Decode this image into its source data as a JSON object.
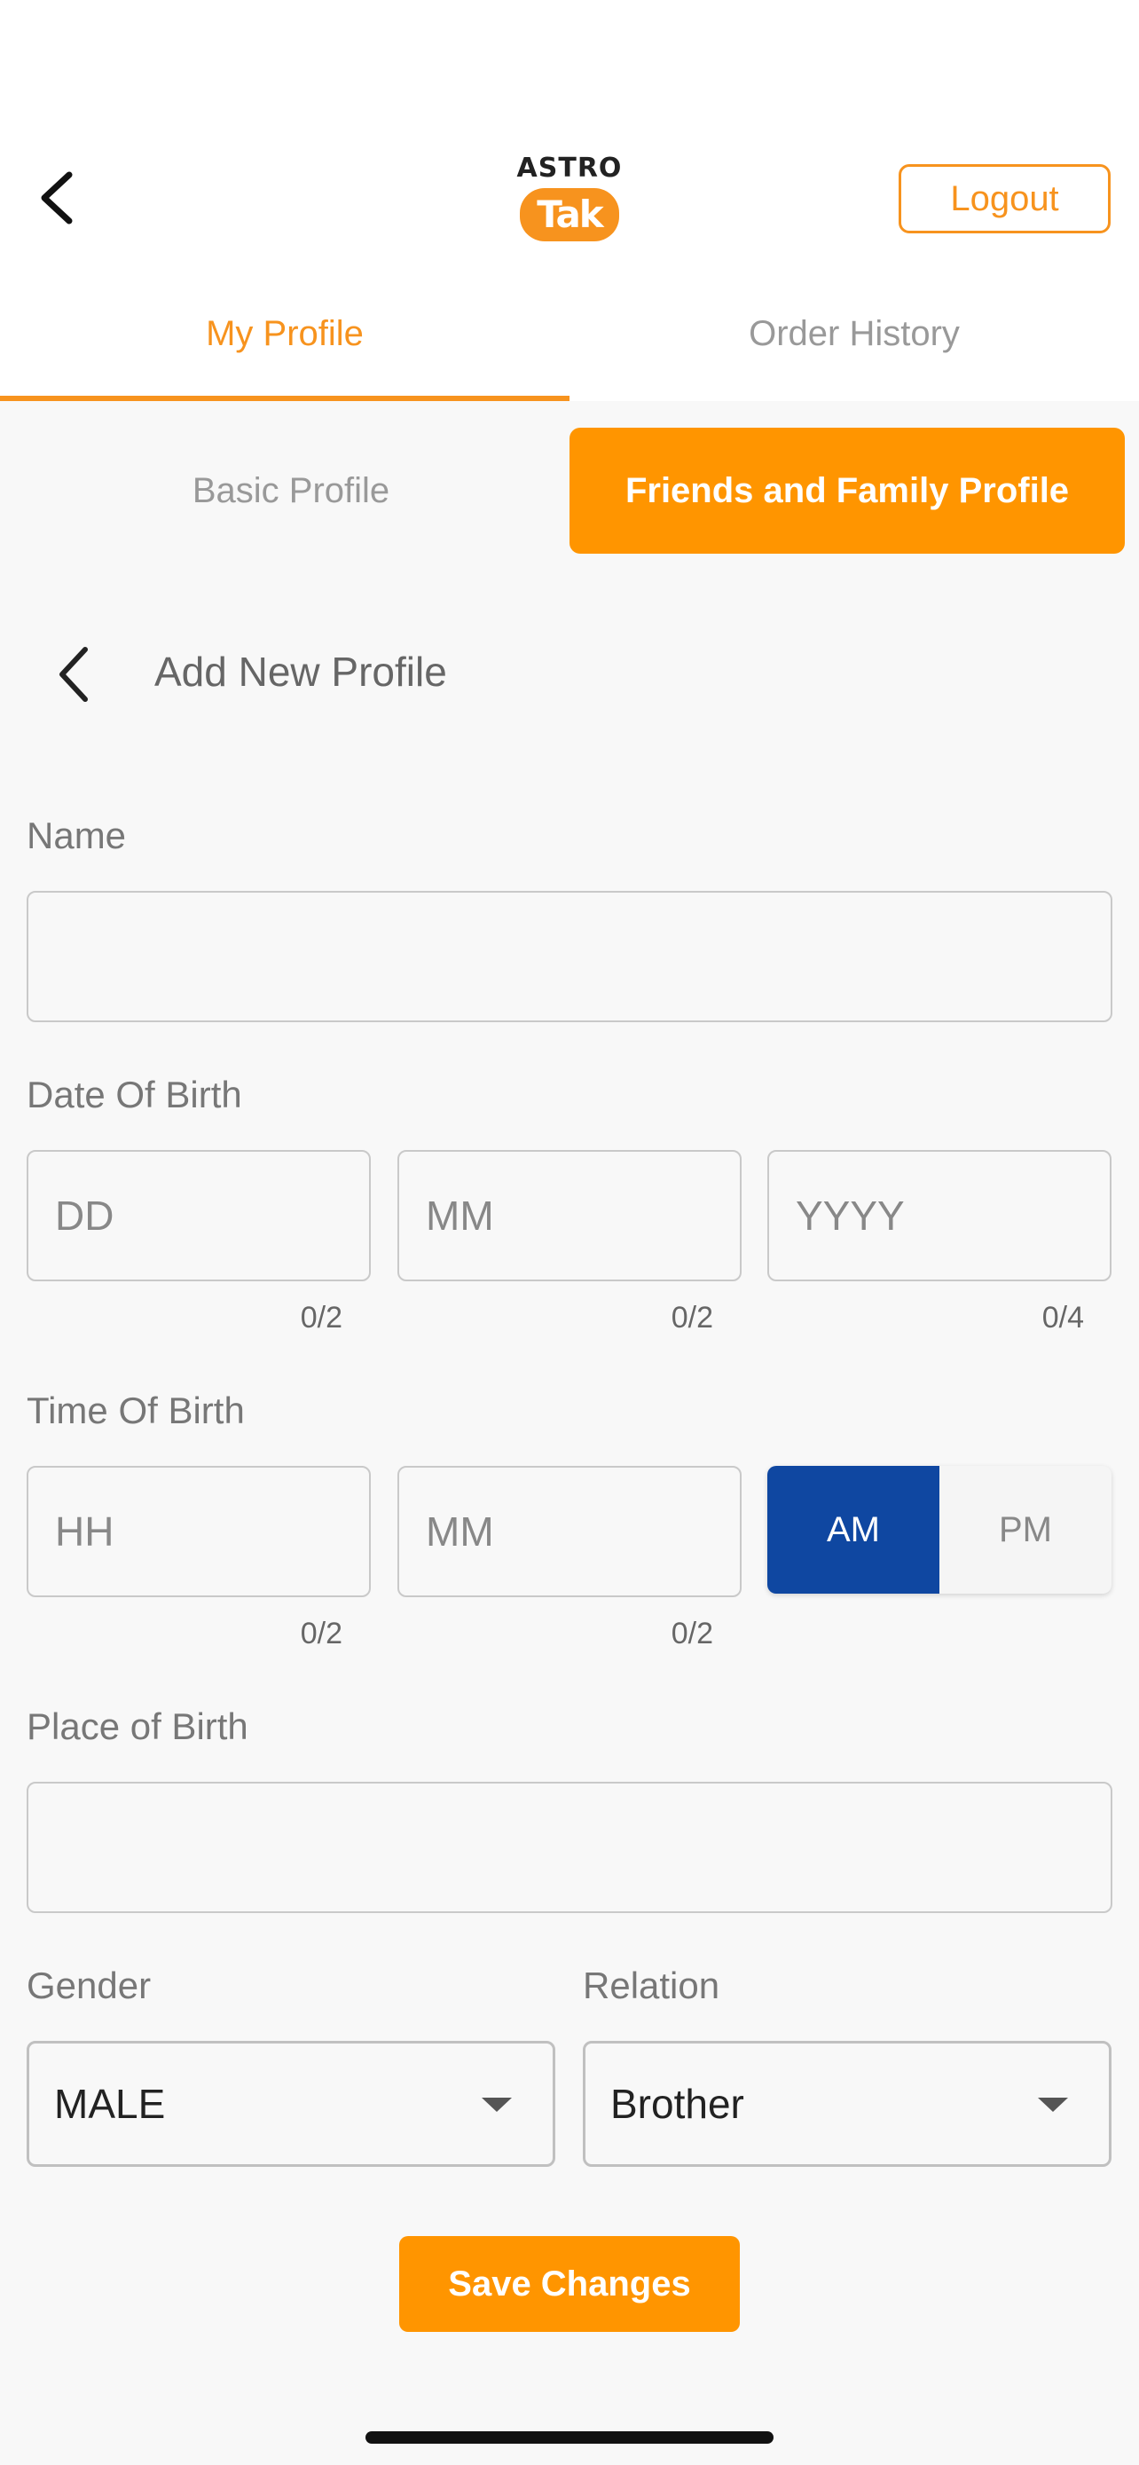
{
  "header": {
    "logo_top": "ASTRO",
    "logo_bottom": "Tak",
    "logout_label": "Logout",
    "brand_color": "#f7931e"
  },
  "tabs": [
    {
      "label": "My Profile",
      "active": true
    },
    {
      "label": "Order History",
      "active": false
    }
  ],
  "segments": [
    {
      "label": "Basic Profile",
      "active": false
    },
    {
      "label": "Friends and Family Profile",
      "active": true
    }
  ],
  "subheader": {
    "title": "Add New Profile"
  },
  "form": {
    "name": {
      "label": "Name",
      "value": ""
    },
    "dob": {
      "label": "Date Of Birth",
      "day": {
        "placeholder": "DD",
        "counter": "0/2"
      },
      "month": {
        "placeholder": "MM",
        "counter": "0/2"
      },
      "year": {
        "placeholder": "YYYY",
        "counter": "0/4"
      }
    },
    "tob": {
      "label": "Time Of Birth",
      "hour": {
        "placeholder": "HH",
        "counter": "0/2"
      },
      "minute": {
        "placeholder": "MM",
        "counter": "0/2"
      },
      "am_label": "AM",
      "pm_label": "PM",
      "selected": "AM"
    },
    "place": {
      "label": "Place of Birth",
      "value": ""
    },
    "gender": {
      "label": "Gender",
      "value": "MALE"
    },
    "relation": {
      "label": "Relation",
      "value": "Brother"
    },
    "save_label": "Save Changes"
  },
  "colors": {
    "accent": "#ff9500",
    "am_selected": "#0f47a1"
  }
}
